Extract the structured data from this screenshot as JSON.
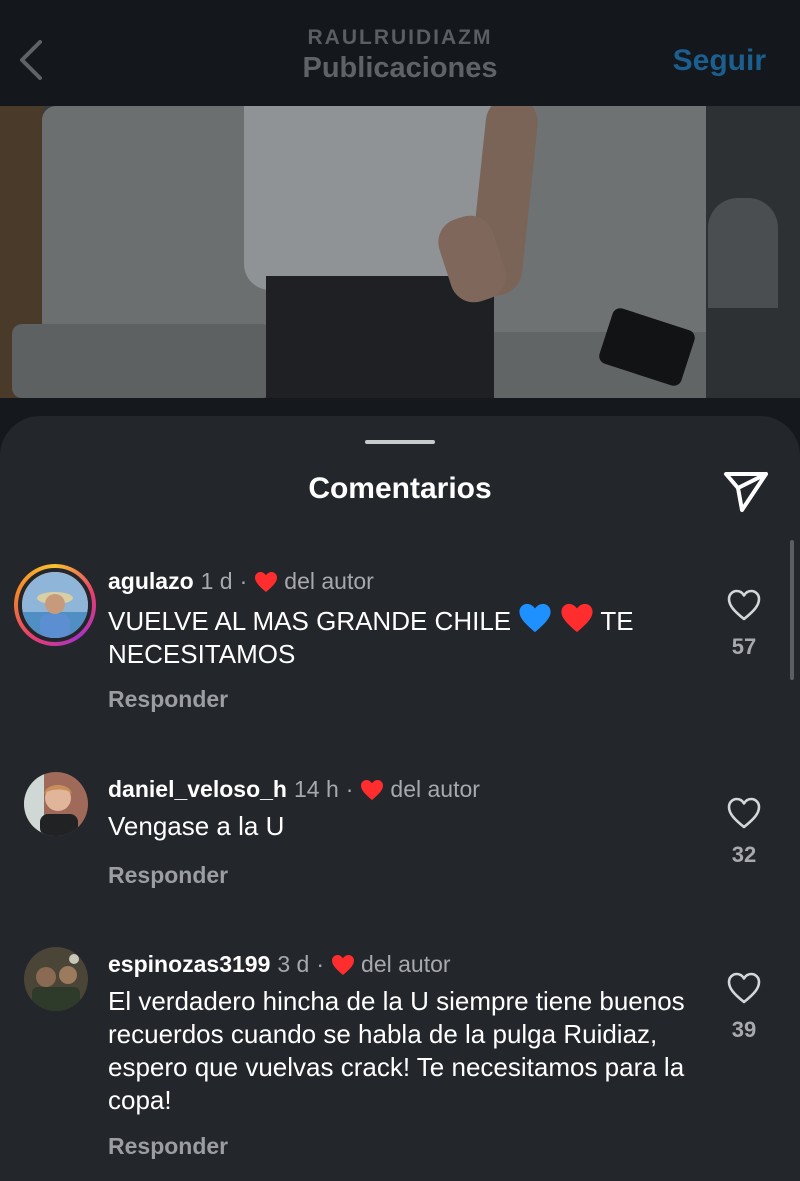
{
  "header": {
    "username": "RAULRUIDIAZM",
    "title": "Publicaciones",
    "follow_label": "Seguir"
  },
  "sheet": {
    "title": "Comentarios"
  },
  "comments": [
    {
      "username": "agulazo",
      "time": "1 d",
      "separator": "·",
      "author_label": "del autor",
      "text_before": "VUELVE AL MAS GRANDE CHILE",
      "text_after": "TE NECESITAMOS",
      "emojis": [
        "blue-heart",
        "red-heart"
      ],
      "reply_label": "Responder",
      "likes": "57",
      "has_story_ring": true
    },
    {
      "username": "daniel_veloso_h",
      "time": "14 h",
      "separator": "·",
      "author_label": "del autor",
      "text": "Vengase a la U",
      "reply_label": "Responder",
      "likes": "32",
      "has_story_ring": false
    },
    {
      "username": "espinozas3199",
      "time": "3 d",
      "separator": "·",
      "author_label": "del autor",
      "text": "El verdadero hincha de la U siempre tiene buenos recuerdos cuando se habla de la pulga Ruidiaz, espero que vuelvas crack! Te necesitamos para la copa!",
      "reply_label": "Responder",
      "likes": "39",
      "has_story_ring": false
    }
  ],
  "colors": {
    "background": "#23262b",
    "header": "#14171b",
    "follow": "#1a5f8f",
    "heart_red": "#ff2d2d",
    "heart_blue": "#1e90ff",
    "muted": "#a7a9ad"
  }
}
